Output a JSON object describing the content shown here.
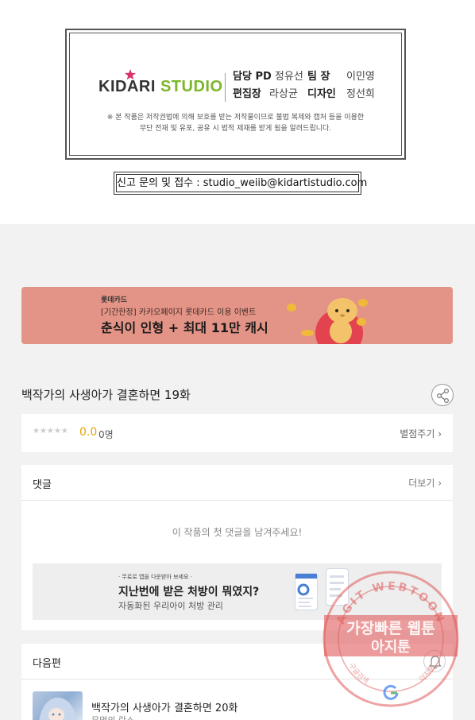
{
  "credits": {
    "logo_kid": "KIDARI",
    "logo_studio": "STUDIO",
    "pd_role": "담당 PD",
    "pd_name": "정유선",
    "team_role": "팀 장",
    "team_name": "이민영",
    "editor_role": "편집장",
    "editor_name": "라상균",
    "designer_role": "디자인",
    "designer_name": "정선희",
    "copyright_line1": "※ 본 작품은 저작권법에 의해 보호를 받는 저작물이므로 불법 복제와 캡처 등을 이용한",
    "copyright_line2": "무단 전재 및 유포, 공유 시 법적 제재를 받게 됨을 알려드립니다.",
    "report": "신고 문의 및 접수 : studio_weiib@kidartistudio.com"
  },
  "ad_banner": {
    "brand": "롯데카드",
    "sub": "[기간한정] 카카오페이지 롯데카드 이용 이벤트",
    "main": "춘식이 인형 + 최대 11만 캐시"
  },
  "episode": {
    "title": "백작가의 사생아가 결혼하면 19화",
    "share_icon": "share-icon"
  },
  "rating": {
    "stars": "★★★★★",
    "score": "0.0",
    "count": "0명",
    "rate_link": "별점주기 ›",
    "score_color": "#e6a400"
  },
  "comments": {
    "title": "댓글",
    "more": "더보기 ›",
    "empty": "이 작품의 첫 댓글을 남겨주세요!"
  },
  "ad_inline": {
    "note": "· 무료로 앱을 다운받아 보세요 ·",
    "main": "지난번에 받은 처방이 뭐였지?",
    "sub": "자동화된 우리아이 처방 관리"
  },
  "next": {
    "title": "다음편",
    "ep_title": "백작가의 사생아가 결혼하면 20화",
    "ep_sub": "무명의 란스"
  },
  "watermark": {
    "top_arc": "AGIT WEBTOON",
    "line1": "가장빠른 웹툰",
    "line2": "아지툰",
    "left_arc": "구글검색",
    "right_arc": "아지툰",
    "color": "#e05a5a"
  }
}
